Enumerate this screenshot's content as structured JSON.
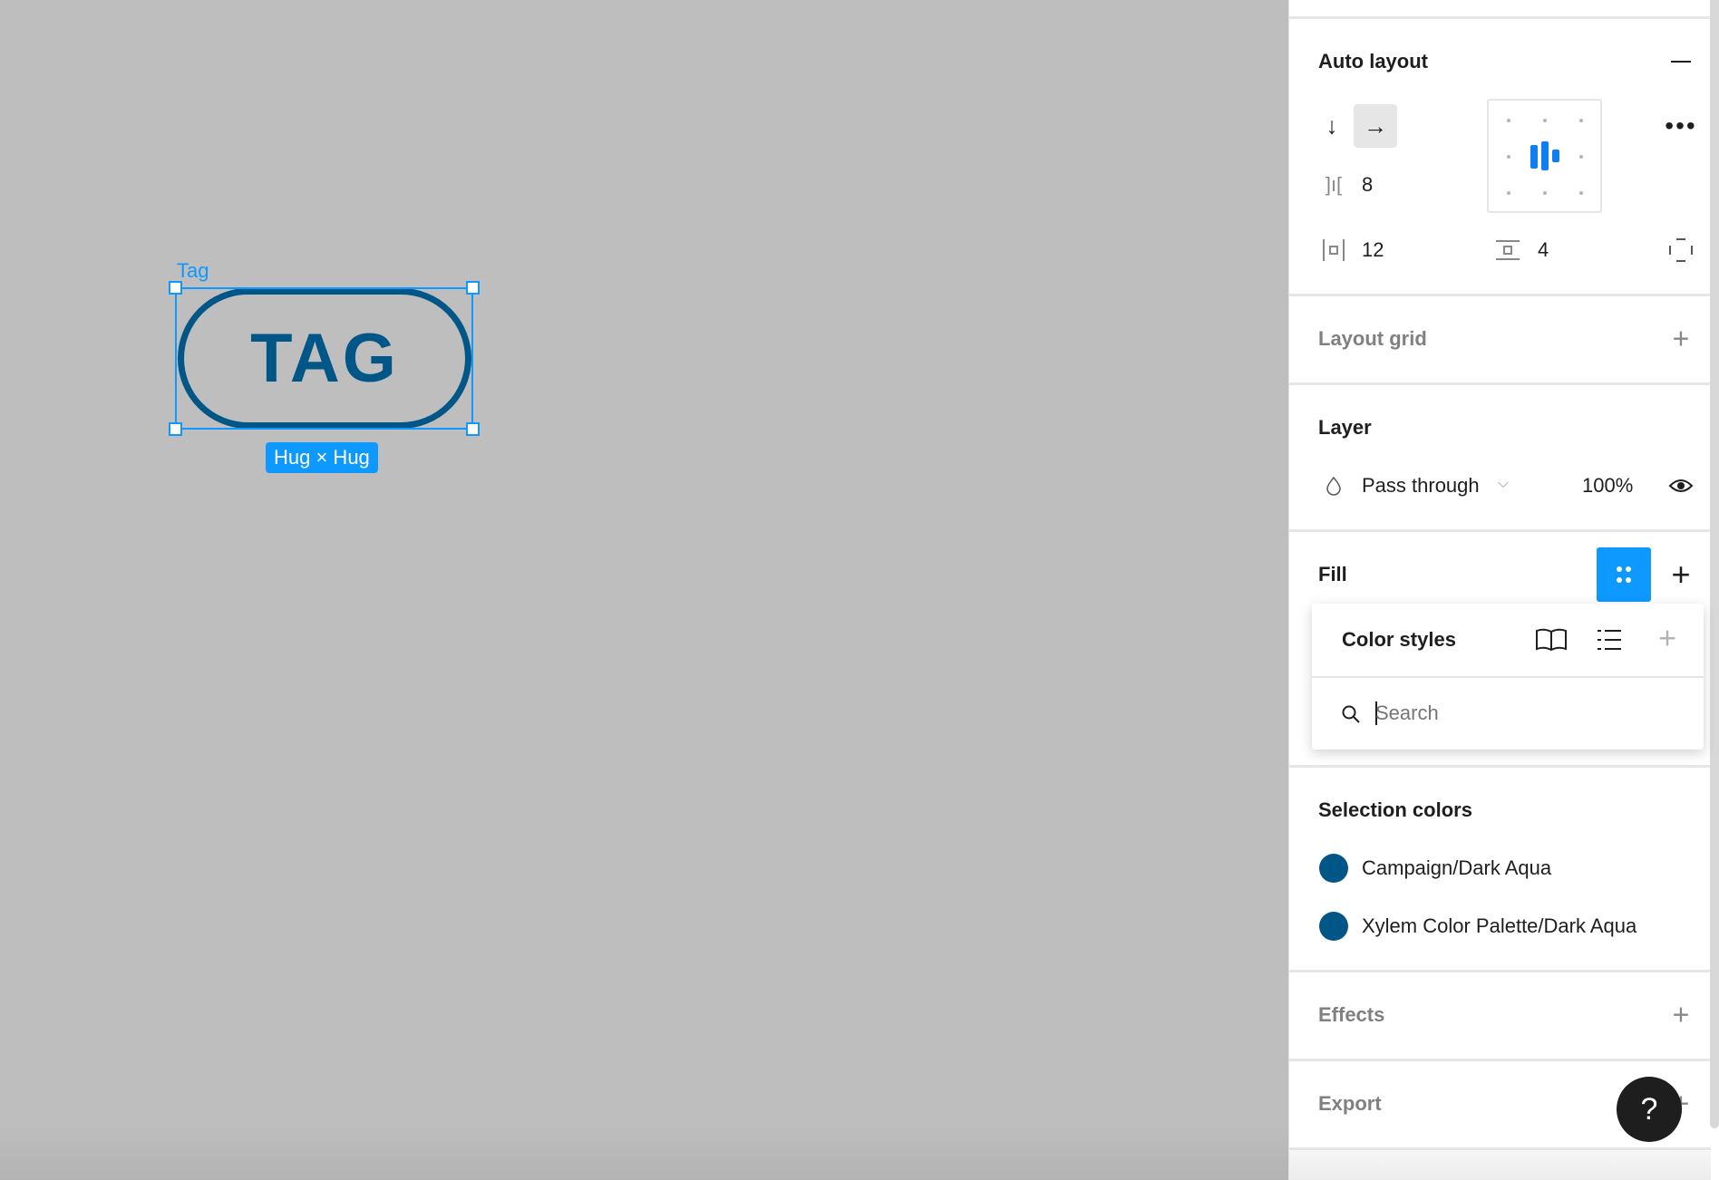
{
  "canvas": {
    "frame_name": "Tag",
    "tag_text": "TAG",
    "size_badge": "Hug × Hug",
    "tag_color": "#005687",
    "selection_color": "#0d99ff"
  },
  "panel": {
    "auto_layout": {
      "title": "Auto layout",
      "direction": "horizontal",
      "spacing": "8",
      "padding_horizontal": "12",
      "padding_vertical": "4",
      "alignment": "center"
    },
    "layout_grid": {
      "title": "Layout grid"
    },
    "layer": {
      "title": "Layer",
      "blend_mode": "Pass through",
      "opacity": "100%"
    },
    "fill": {
      "title": "Fill"
    },
    "color_styles_popover": {
      "title": "Color styles",
      "search_placeholder": "Search",
      "search_value": ""
    },
    "selection_colors": {
      "title": "Selection colors",
      "items": [
        {
          "name": "Campaign/Dark Aqua",
          "color": "#005687"
        },
        {
          "name": "Xylem Color Palette/Dark Aqua",
          "color": "#005687"
        }
      ]
    },
    "effects": {
      "title": "Effects"
    },
    "export": {
      "title": "Export"
    },
    "help": {
      "label": "?"
    }
  }
}
